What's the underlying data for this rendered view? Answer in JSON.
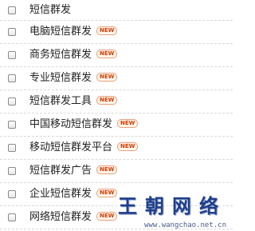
{
  "items": [
    {
      "label": "短信群发",
      "badge": ""
    },
    {
      "label": "电脑短信群发",
      "badge": "NEW"
    },
    {
      "label": "商务短信群发",
      "badge": "NEW"
    },
    {
      "label": "专业短信群发",
      "badge": "NEW"
    },
    {
      "label": "短信群发工具",
      "badge": "NEW"
    },
    {
      "label": "中国移动短信群发",
      "badge": "NEW"
    },
    {
      "label": "移动短信群发平台",
      "badge": "NEW"
    },
    {
      "label": "短信群发广告",
      "badge": "NEW"
    },
    {
      "label": "企业短信群发",
      "badge": "NEW"
    },
    {
      "label": "网络短信群发",
      "badge": "NEW"
    }
  ],
  "watermark": {
    "brand": "王朝网络",
    "url": "www.wangchao.net.cn"
  }
}
